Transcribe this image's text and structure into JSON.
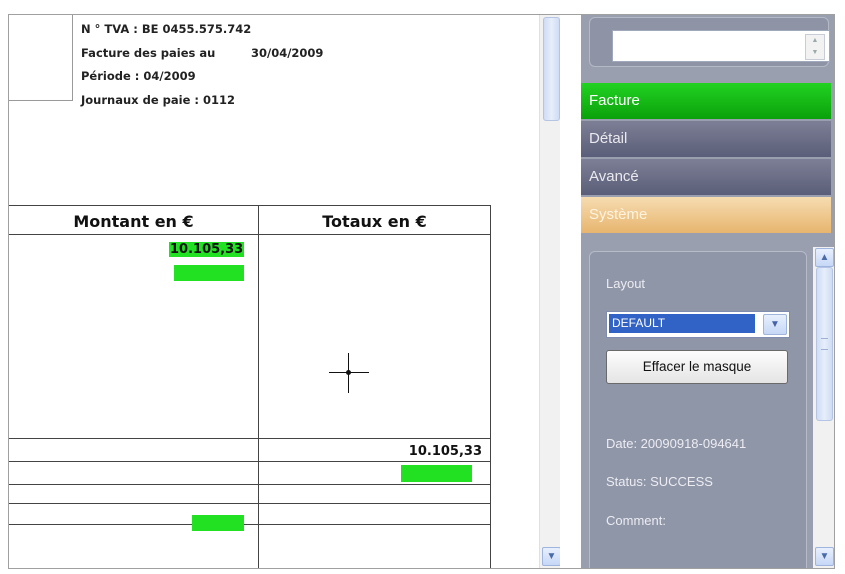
{
  "document": {
    "header": {
      "vat": "N ° TVA : BE 0455.575.742",
      "invoice_label": "Facture des paies au",
      "invoice_date": "30/04/2009",
      "period": "Période : 04/2009",
      "journal": "Journaux de paie : 0112"
    },
    "table": {
      "col1_header": "Montant en €",
      "col2_header": "Totaux en €",
      "amount": "10.105,33",
      "total": "10.105,33"
    }
  },
  "panel": {
    "nav": {
      "facture": "Facture",
      "detail": "Détail",
      "avance": "Avancé",
      "systeme": "Système"
    },
    "system": {
      "layout_label": "Layout",
      "layout_value": "DEFAULT",
      "clear_button": "Effacer le masque",
      "date": "Date: 20090918-094641",
      "status": "Status: SUCCESS",
      "comment": "Comment:"
    }
  },
  "colors": {
    "highlight_green": "#22e022",
    "active_nav": "#0aa10a",
    "system_nav": "#e7b56e",
    "panel_bg": "#9a9fb0"
  }
}
